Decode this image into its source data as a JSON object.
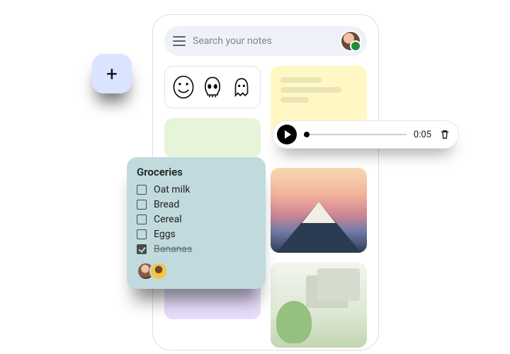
{
  "search": {
    "placeholder": "Search your notes"
  },
  "add_button": {
    "label": "+"
  },
  "audio": {
    "duration": "0:05"
  },
  "groceries": {
    "title": "Groceries",
    "items": [
      {
        "label": "Oat milk",
        "checked": false
      },
      {
        "label": "Bread",
        "checked": false
      },
      {
        "label": "Cereal",
        "checked": false
      },
      {
        "label": "Eggs",
        "checked": false
      },
      {
        "label": "Bananas",
        "checked": true
      }
    ]
  },
  "notes": {
    "drawing": {
      "icons": [
        "smiley-face-icon",
        "skull-icon",
        "ghost-icon"
      ]
    },
    "colors": {
      "yellow": "#fff8c4",
      "green": "#e6f4d9",
      "purple": "#e8defc",
      "groceries_bg": "#c1dade",
      "add_bg": "#dbe4ff"
    }
  }
}
